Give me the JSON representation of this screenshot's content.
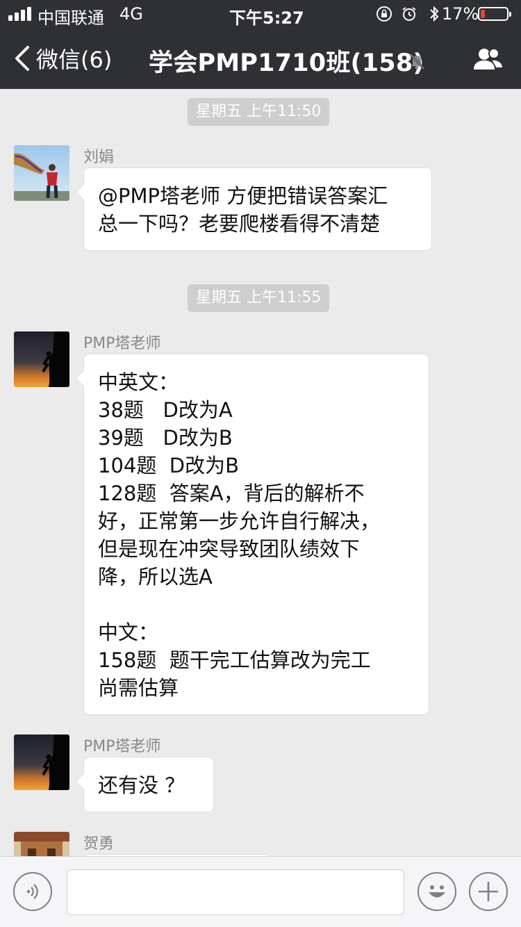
{
  "status_bar": {
    "carrier": "中国联通",
    "network": "4G",
    "time": "下午5:27",
    "battery_percent": "17%",
    "battery_level": 0.17,
    "icons": [
      "signal-icon",
      "orientation-lock-icon",
      "alarm-icon",
      "bluetooth-icon",
      "battery-icon"
    ]
  },
  "nav": {
    "back_label": "微信(6)",
    "title": "学会PMP1710班(158)",
    "icons": [
      "back-chevron-icon",
      "mute-icon",
      "group-members-icon"
    ]
  },
  "messages": [
    {
      "type": "time",
      "text": "星期五 上午11:50"
    },
    {
      "type": "message",
      "sender": "刘娟",
      "avatar": "user-avatar-photo",
      "lines": [
        "@PMP塔老师 方便把错误答案汇",
        "总一下吗？老要爬楼看得不清楚"
      ]
    },
    {
      "type": "time",
      "text": "星期五 上午11:55"
    },
    {
      "type": "message",
      "sender": "PMP塔老师",
      "avatar": "climber-sunset-avatar",
      "lines": [
        "中英文：",
        "38题   D改为A",
        "39题   D改为B",
        "104题  D改为B",
        "128题  答案A，背后的解析不",
        "好，正常第一步允许自行解决，",
        "但是现在冲突导致团队绩效下",
        "降，所以选A",
        "",
        "中文：",
        "158题  题干完工估算改为完工",
        "尚需估算"
      ]
    },
    {
      "type": "message",
      "sender": "PMP塔老师",
      "avatar": "climber-sunset-avatar",
      "lines": [
        "还有没 ？"
      ]
    },
    {
      "type": "message",
      "sender": "贺勇",
      "avatar": "building-avatar",
      "lines": []
    }
  ],
  "input_bar": {
    "input_value": "",
    "icons": [
      "voice-icon",
      "emoji-icon",
      "plus-icon"
    ]
  },
  "colors": {
    "topbar": "#2e3033",
    "background": "#ebebeb",
    "bubble": "#ffffff",
    "time_pill": "#cecece",
    "battery_low": "#e64340"
  }
}
